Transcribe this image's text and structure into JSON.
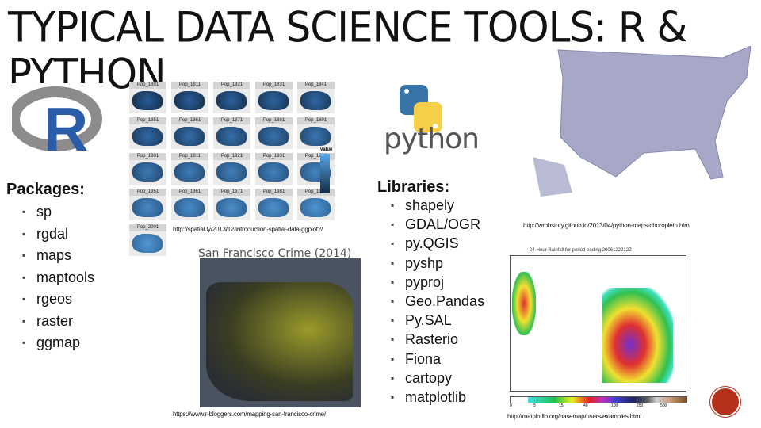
{
  "title": "TYPICAL DATA SCIENCE TOOLS: R & PYTHON",
  "r": {
    "header": "Packages:",
    "items": [
      "sp",
      "rgdal",
      "maps",
      "maptools",
      "rgeos",
      "raster",
      "ggmap"
    ],
    "logo_text": "R",
    "facets": [
      "Pop_1801",
      "Pop_1811",
      "Pop_1821",
      "Pop_1831",
      "Pop_1841",
      "Pop_1851",
      "Pop_1861",
      "Pop_1871",
      "Pop_1881",
      "Pop_1891",
      "Pop_1901",
      "Pop_1911",
      "Pop_1921",
      "Pop_1931",
      "Pop_1939",
      "Pop_1951",
      "Pop_1961",
      "Pop_1971",
      "Pop_1981",
      "Pop_1991",
      "Pop_2001"
    ],
    "legend_title": "value",
    "plot_url": "http://spatial.ly/2013/12/introduction-spatial-data-ggplot2/",
    "sf_title": "San Francisco Crime (2014)",
    "sf_url": "https://www.r-bloggers.com/mapping-san-francisco-crime/"
  },
  "python": {
    "header": "Libraries:",
    "items": [
      "shapely",
      "GDAL/OGR",
      "py.QGIS",
      "pyshp",
      "pyproj",
      "Geo.Pandas",
      "Py.SAL",
      "Rasterio",
      "Fiona",
      "cartopy",
      "matplotlib"
    ],
    "logo_text": "python",
    "choropleth_url": "http://wrobstory.github.io/2013/04/python-maps-choropleth.html",
    "rain_title": "24-Hour Rainfall for period ending 2006122212Z",
    "rain_ticks": [
      "0",
      "5",
      "15",
      "40",
      "100",
      "250",
      "500"
    ],
    "rain_url": "http://matplotlib.org/basemap/users/examples.html"
  },
  "colors": {
    "accent": "#b5311c",
    "r_blue": "#1f4d8c",
    "py_blue": "#3775a9",
    "py_yellow": "#f7d04a"
  }
}
